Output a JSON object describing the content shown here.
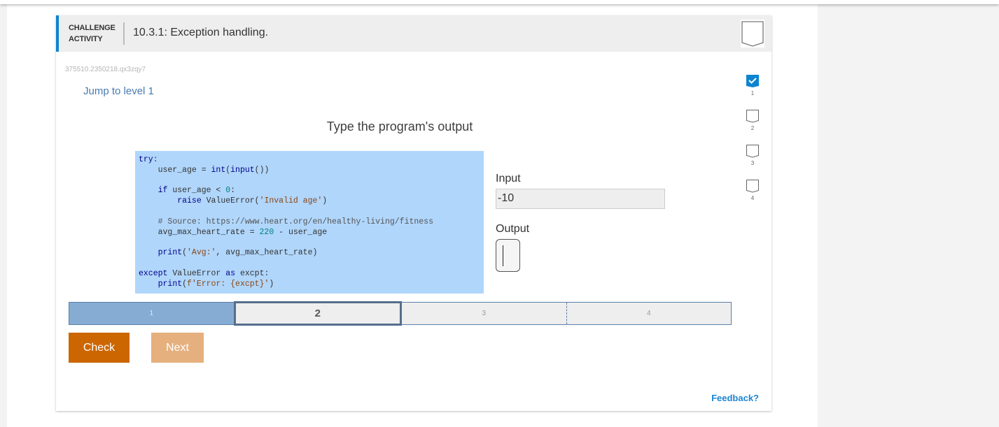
{
  "header": {
    "activity_type_line1": "CHALLENGE",
    "activity_type_line2": "ACTIVITY",
    "title": "10.3.1: Exception handling.",
    "completion_badge_icon": "completion-badge-empty-icon"
  },
  "activity_id": "375510.2350218.qx3zqy7",
  "jump_link": "Jump to level 1",
  "instructions": "Type the program's output",
  "code": {
    "language": "python",
    "lines": [
      "try:",
      "    user_age = int(input())",
      "",
      "    if user_age < 0:",
      "        raise ValueError('Invalid age')",
      "",
      "    # Source: https://www.heart.org/en/healthy-living/fitness",
      "    avg_max_heart_rate = 220 - user_age",
      "",
      "    print('Avg:', avg_max_heart_rate)",
      "",
      "except ValueError as excpt:",
      "    print(f'Error: {excpt}')"
    ]
  },
  "io": {
    "input_label": "Input",
    "input_value": "-10",
    "output_label": "Output",
    "output_value": ""
  },
  "levels": [
    {
      "label": "1",
      "state": "completed"
    },
    {
      "label": "2",
      "state": "current"
    },
    {
      "label": "3",
      "state": "locked"
    },
    {
      "label": "4",
      "state": "locked"
    }
  ],
  "buttons": {
    "check": "Check",
    "next": "Next"
  },
  "side_levels": [
    {
      "label": "1",
      "completed": true
    },
    {
      "label": "2",
      "completed": false
    },
    {
      "label": "3",
      "completed": false
    },
    {
      "label": "4",
      "completed": false
    }
  ],
  "feedback_link": "Feedback?",
  "colors": {
    "accent_blue": "#0c84d0",
    "check_button": "#cc6600",
    "next_button_disabled": "#e5b07e",
    "level_completed": "#86acd3",
    "code_background": "#b0d6fb"
  }
}
